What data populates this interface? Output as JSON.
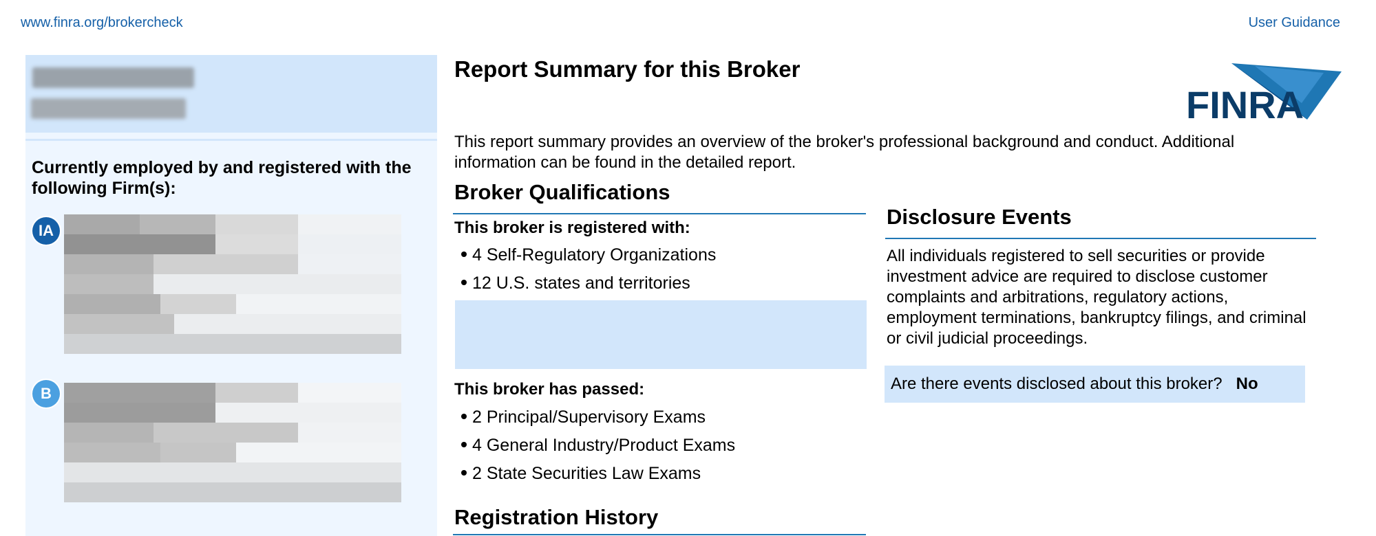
{
  "header": {
    "url_link": "www.finra.org/brokercheck",
    "guidance_link": "User Guidance"
  },
  "left_panel": {
    "employed_heading": "Currently employed by and registered with the following Firm(s):",
    "firms": [
      {
        "badge": "IA",
        "badge_color": "#1560a8"
      },
      {
        "badge": "B",
        "badge_color": "#4ba0e0"
      }
    ]
  },
  "main": {
    "title": "Report Summary for this Broker",
    "logo_text": "FINRA",
    "intro": "This report summary provides an overview of the broker's professional background and conduct. Additional information can be found in the detailed report.",
    "qualifications": {
      "title": "Broker Qualifications",
      "registered_heading": "This broker is registered with:",
      "registered_items": [
        "4 Self-Regulatory Organizations",
        "12 U.S. states and territories"
      ],
      "passed_heading": "This broker has passed:",
      "passed_items": [
        "2 Principal/Supervisory Exams",
        "4 General Industry/Product Exams",
        "2 State Securities Law Exams"
      ]
    },
    "registration_history_title": "Registration History"
  },
  "disclosure": {
    "title": "Disclosure Events",
    "text": "All individuals registered to sell securities or provide investment advice are required to disclose customer complaints and arbitrations, regulatory actions, employment terminations, bankruptcy filings, and criminal or civil judicial proceedings.",
    "question": "Are there events disclosed about this broker?",
    "answer": "No"
  },
  "colors": {
    "accent": "#1560a8",
    "panel_light": "#eef6ff",
    "panel_box": "#d2e6fb",
    "rule": "#1f77b4"
  }
}
